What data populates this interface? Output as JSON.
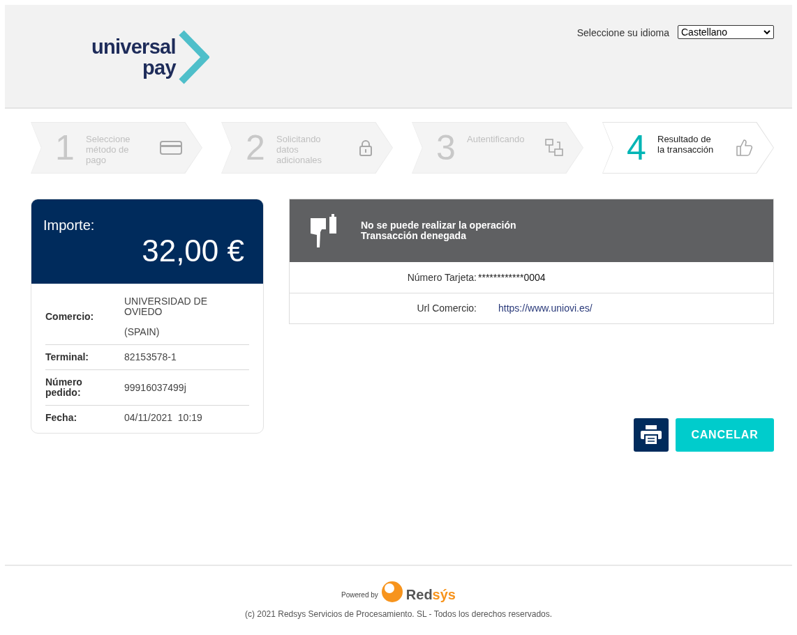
{
  "header": {
    "logo": {
      "line_1": "universal",
      "line_2": "pay"
    },
    "language": {
      "label": "Seleccione su idioma",
      "value": "Castellano"
    }
  },
  "steps": [
    {
      "number": "1",
      "label": "Seleccione método de pago",
      "kind": "card",
      "selected": false
    },
    {
      "number": "2",
      "label": "Solicitando datos adicionales",
      "kind": "lock",
      "selected": false
    },
    {
      "number": "3",
      "label": "Autentificando",
      "kind": "diagram",
      "selected": false
    },
    {
      "number": "4",
      "label": "Resultado de la transacción",
      "kind": "thumb",
      "selected": true
    }
  ],
  "summary": {
    "amount_label": "Importe:",
    "amount": "32,00 €",
    "rows": [
      {
        "label": "Comercio:",
        "values": [
          "UNIVERSIDAD DE OVIEDO",
          "(SPAIN)"
        ]
      },
      {
        "label": "Terminal:",
        "values": [
          "82153578-1"
        ]
      },
      {
        "label": "Número pedido:",
        "values": [
          "99916037499j"
        ]
      },
      {
        "label": "Fecha:",
        "values": [
          "04/11/2021  10:19"
        ]
      }
    ]
  },
  "result": {
    "title": "No se puede realizar la operación",
    "subtitle": "Transacción denegada",
    "rows": [
      {
        "kind": "text",
        "label": "Número Tarjeta:",
        "value": "************0004"
      },
      {
        "kind": "link",
        "label": "Url Comercio:",
        "value": "https://www.uniovi.es/"
      }
    ]
  },
  "buttons": {
    "cancel": "CANCELAR"
  },
  "footer": {
    "powered_by": "Powered by",
    "brand_main": "Red",
    "brand_accent": "sýs",
    "copyright": "(c) 2021 Redsys Servicios de Procesamiento. SL - Todos los derechos reservados."
  }
}
